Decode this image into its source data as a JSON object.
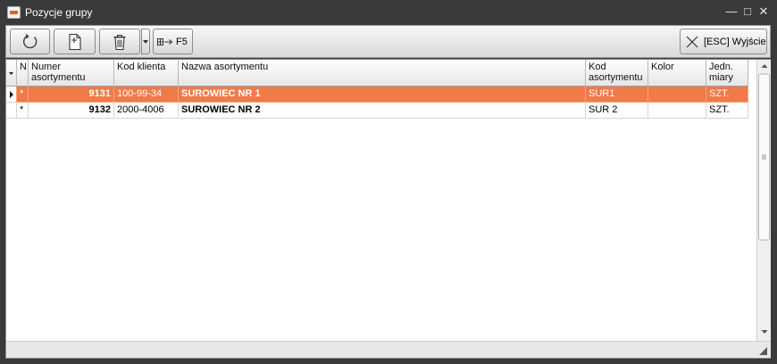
{
  "window": {
    "title": "Pozycje grupy",
    "app_icon": "app-logo-icon"
  },
  "controls": {
    "minimize": "—",
    "maximize": "□",
    "close": "✕"
  },
  "toolbar": {
    "refresh_icon": "refresh-icon",
    "new_icon": "new-document-icon",
    "delete_icon": "trash-icon",
    "f5_label": "F5",
    "exit_label": "[ESC] Wyjście"
  },
  "grid": {
    "columns": [
      {
        "key": "n",
        "label": "N"
      },
      {
        "key": "numer",
        "label": "Numer asortymentu"
      },
      {
        "key": "kod_klienta",
        "label": "Kod klienta"
      },
      {
        "key": "nazwa",
        "label": "Nazwa asortymentu"
      },
      {
        "key": "kod_asort",
        "label": "Kod\nasortymentu"
      },
      {
        "key": "kolor",
        "label": "Kolor"
      },
      {
        "key": "jm",
        "label": "Jedn.\nmiary"
      }
    ],
    "rows": [
      {
        "n": "*",
        "numer": "9131",
        "kod_klienta": "100-99-34",
        "nazwa": "SUROWIEC NR 1",
        "kod_asort": "SUR1",
        "kolor": "",
        "jm": "SZT.",
        "selected": true
      },
      {
        "n": "*",
        "numer": "9132",
        "kod_klienta": "2000-4006",
        "nazwa": "SUROWIEC NR 2",
        "kod_asort": "SUR 2",
        "kolor": "",
        "jm": "SZT.",
        "selected": false
      }
    ]
  },
  "colors": {
    "selection": "#f07a48",
    "titlebar": "#3a3a3a"
  }
}
